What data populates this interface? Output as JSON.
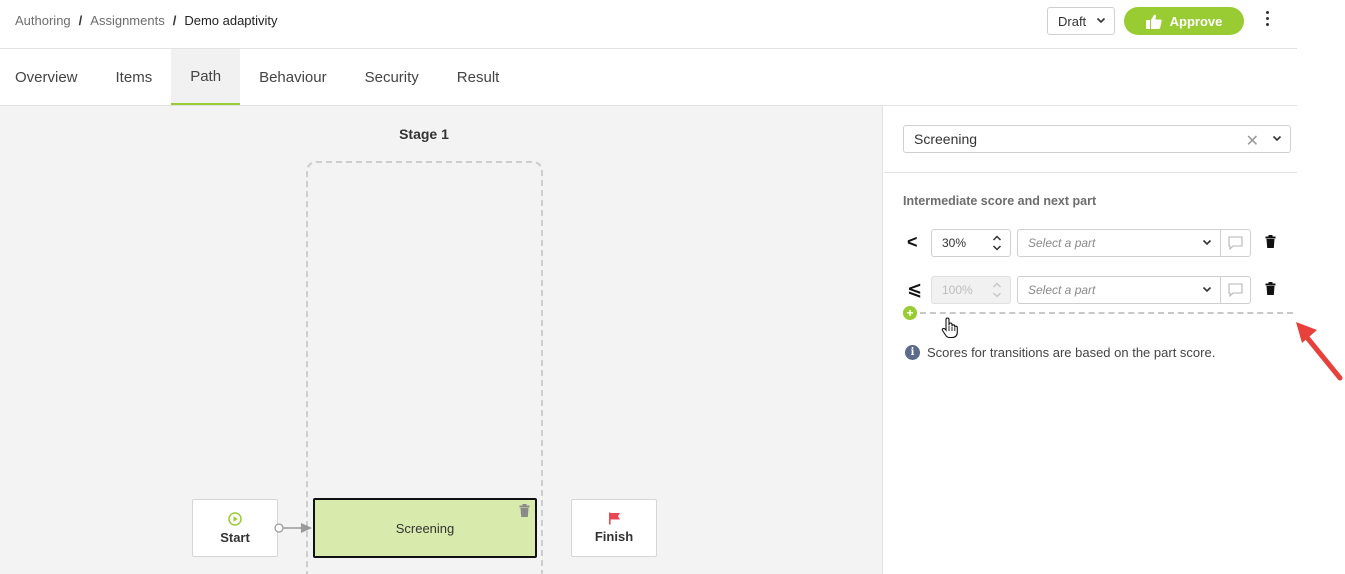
{
  "header": {
    "breadcrumb": [
      "Authoring",
      "Assignments",
      "Demo adaptivity"
    ],
    "separator": "/",
    "status_select": "Draft",
    "approve_label": "Approve"
  },
  "tabs": [
    {
      "label": "Overview",
      "active": false
    },
    {
      "label": "Items",
      "active": false
    },
    {
      "label": "Path",
      "active": true
    },
    {
      "label": "Behaviour",
      "active": false
    },
    {
      "label": "Security",
      "active": false
    },
    {
      "label": "Result",
      "active": false
    }
  ],
  "canvas": {
    "stage_title": "Stage 1",
    "start_label": "Start",
    "part_label": "Screening",
    "finish_label": "Finish"
  },
  "panel": {
    "selected_part": "Screening",
    "section_title": "Intermediate score and next part",
    "rules": [
      {
        "operator": "<",
        "score": "30%",
        "part_placeholder": "Select a part",
        "disabled": false
      },
      {
        "operator": "⩽",
        "score": "100%",
        "part_placeholder": "Select a part",
        "disabled": true
      }
    ],
    "info_text": "Scores for transitions are based on the part score."
  },
  "colors": {
    "accent": "#99cc33",
    "part_fill": "#d9ebac",
    "annotation_arrow": "#e8403a",
    "canvas_bg": "#f2f3f2"
  },
  "icons": [
    "chevron-down-icon",
    "thumbs-up-icon",
    "kebab-menu-icon",
    "play-circle-icon",
    "flag-icon",
    "trash-icon",
    "clear-icon",
    "spinner-icon",
    "comment-icon",
    "plus-circle-icon",
    "hand-cursor-icon",
    "info-icon",
    "red-arrow-annotation"
  ]
}
